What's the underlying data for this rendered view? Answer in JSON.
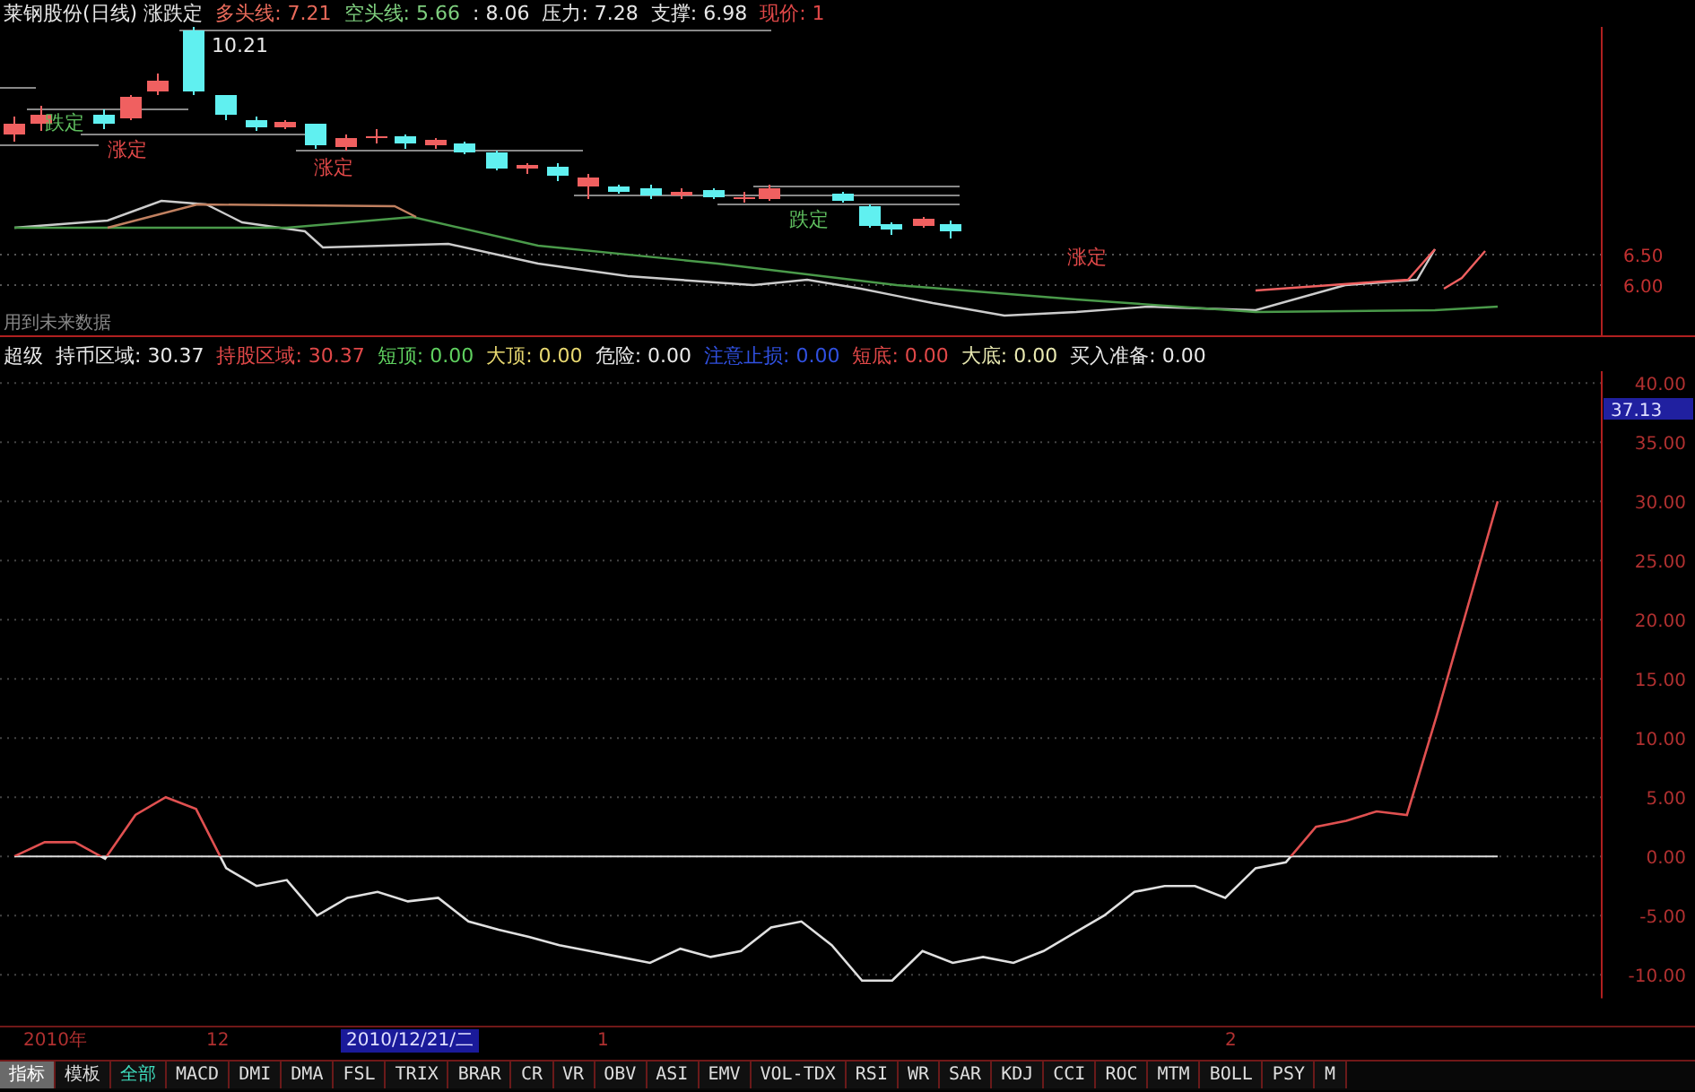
{
  "price_panel": {
    "header": [
      {
        "text": "莱钢股份(日线) 涨跌定",
        "color": "#e8e8e8"
      },
      {
        "text": "多头线: 7.21",
        "color": "#e86a5a"
      },
      {
        "text": "空头线: 5.66",
        "color": "#7fd07f"
      },
      {
        "text": ": 8.06",
        "color": "#e8e8e8"
      },
      {
        "text": "压力: 7.28",
        "color": "#e8e8e8"
      },
      {
        "text": "支撑: 6.98",
        "color": "#e8e8e8"
      },
      {
        "text": "现价: 1",
        "color": "#e04848"
      }
    ],
    "high_label": "10.21",
    "signal_labels": [
      {
        "text": "跌定",
        "color": "#5fbf5f"
      },
      {
        "text": "涨定",
        "color": "#e04848"
      },
      {
        "text": "涨定",
        "color": "#e04848"
      },
      {
        "text": "跌定",
        "color": "#5fbf5f"
      },
      {
        "text": "涨定",
        "color": "#e04848"
      }
    ],
    "note": "用到未来数据",
    "axis_labels": [
      "6.50",
      "6.00"
    ]
  },
  "indicator_panel": {
    "header": [
      {
        "text": "超级",
        "color": "#e8e8e8"
      },
      {
        "text": "持币区域: 30.37",
        "color": "#e8e8e8"
      },
      {
        "text": "持股区域: 30.37",
        "color": "#e04848"
      },
      {
        "text": "短顶: 0.00",
        "color": "#5fd05f"
      },
      {
        "text": "大顶: 0.00",
        "color": "#e8d870"
      },
      {
        "text": "危险: 0.00",
        "color": "#e8e8e8"
      },
      {
        "text": "注意止损: 0.00",
        "color": "#3050e0"
      },
      {
        "text": "短底: 0.00",
        "color": "#e04848"
      },
      {
        "text": "大底: 0.00",
        "color": "#e8e8b0"
      },
      {
        "text": "买入准备: 0.00",
        "color": "#e8e8e8"
      }
    ],
    "current_value": "37.13",
    "chart_data": {
      "type": "line",
      "ylim": [
        -12,
        41
      ],
      "grid": true,
      "yticks": [
        {
          "value": 40,
          "label": "40.00"
        },
        {
          "value": 35,
          "label": "35.00"
        },
        {
          "value": 30,
          "label": "30.00"
        },
        {
          "value": 25,
          "label": "25.00"
        },
        {
          "value": 20,
          "label": "20.00"
        },
        {
          "value": 15,
          "label": "15.00"
        },
        {
          "value": 10,
          "label": "10.00"
        },
        {
          "value": 5,
          "label": "5.00"
        },
        {
          "value": 0,
          "label": "0.00"
        },
        {
          "value": -5,
          "label": "-5.00"
        },
        {
          "value": -10,
          "label": "-10.00"
        }
      ],
      "series": [
        {
          "color": "#e05050",
          "values": [
            0,
            1.2,
            1.2,
            -0.2,
            3.5,
            5,
            4,
            -1,
            -2.5,
            -2,
            -5,
            -3.5,
            -3,
            -3.8,
            -3.5,
            -5.5,
            -6.2,
            -6.8,
            -7.5,
            -8,
            -8.5,
            -9,
            -7.8,
            -8.5,
            -8,
            -6,
            -5.5,
            -7.5,
            -10.5,
            -10.5,
            -8,
            -9,
            -8.5,
            -9,
            -8,
            -6.5,
            -5,
            -3,
            -2.5,
            -2.5,
            -3.5,
            -1,
            -0.5,
            2.5,
            3,
            3.8,
            3.5,
            12,
            21,
            30
          ]
        }
      ]
    }
  },
  "date_axis": [
    {
      "text": "2010年",
      "selected": false
    },
    {
      "text": "12",
      "selected": false
    },
    {
      "text": "2010/12/21/二",
      "selected": true
    },
    {
      "text": "1",
      "selected": false
    },
    {
      "text": "2",
      "selected": false
    }
  ],
  "tabs": [
    {
      "label": "指标",
      "selected": true,
      "highlighted": false
    },
    {
      "label": "模板",
      "selected": false,
      "highlighted": false
    },
    {
      "label": "全部",
      "selected": false,
      "highlighted": true
    },
    {
      "label": "MACD",
      "selected": false,
      "highlighted": false
    },
    {
      "label": "DMI",
      "selected": false,
      "highlighted": false
    },
    {
      "label": "DMA",
      "selected": false,
      "highlighted": false
    },
    {
      "label": "FSL",
      "selected": false,
      "highlighted": false
    },
    {
      "label": "TRIX",
      "selected": false,
      "highlighted": false
    },
    {
      "label": "BRAR",
      "selected": false,
      "highlighted": false
    },
    {
      "label": "CR",
      "selected": false,
      "highlighted": false
    },
    {
      "label": "VR",
      "selected": false,
      "highlighted": false
    },
    {
      "label": "OBV",
      "selected": false,
      "highlighted": false
    },
    {
      "label": "ASI",
      "selected": false,
      "highlighted": false
    },
    {
      "label": "EMV",
      "selected": false,
      "highlighted": false
    },
    {
      "label": "VOL-TDX",
      "selected": false,
      "highlighted": false
    },
    {
      "label": "RSI",
      "selected": false,
      "highlighted": false
    },
    {
      "label": "WR",
      "selected": false,
      "highlighted": false
    },
    {
      "label": "SAR",
      "selected": false,
      "highlighted": false
    },
    {
      "label": "KDJ",
      "selected": false,
      "highlighted": false
    },
    {
      "label": "CCI",
      "selected": false,
      "highlighted": false
    },
    {
      "label": "ROC",
      "selected": false,
      "highlighted": false
    },
    {
      "label": "MTM",
      "selected": false,
      "highlighted": false
    },
    {
      "label": "BOLL",
      "selected": false,
      "highlighted": false
    },
    {
      "label": "PSY",
      "selected": false,
      "highlighted": false
    },
    {
      "label": "M",
      "selected": false,
      "highlighted": false
    }
  ]
}
